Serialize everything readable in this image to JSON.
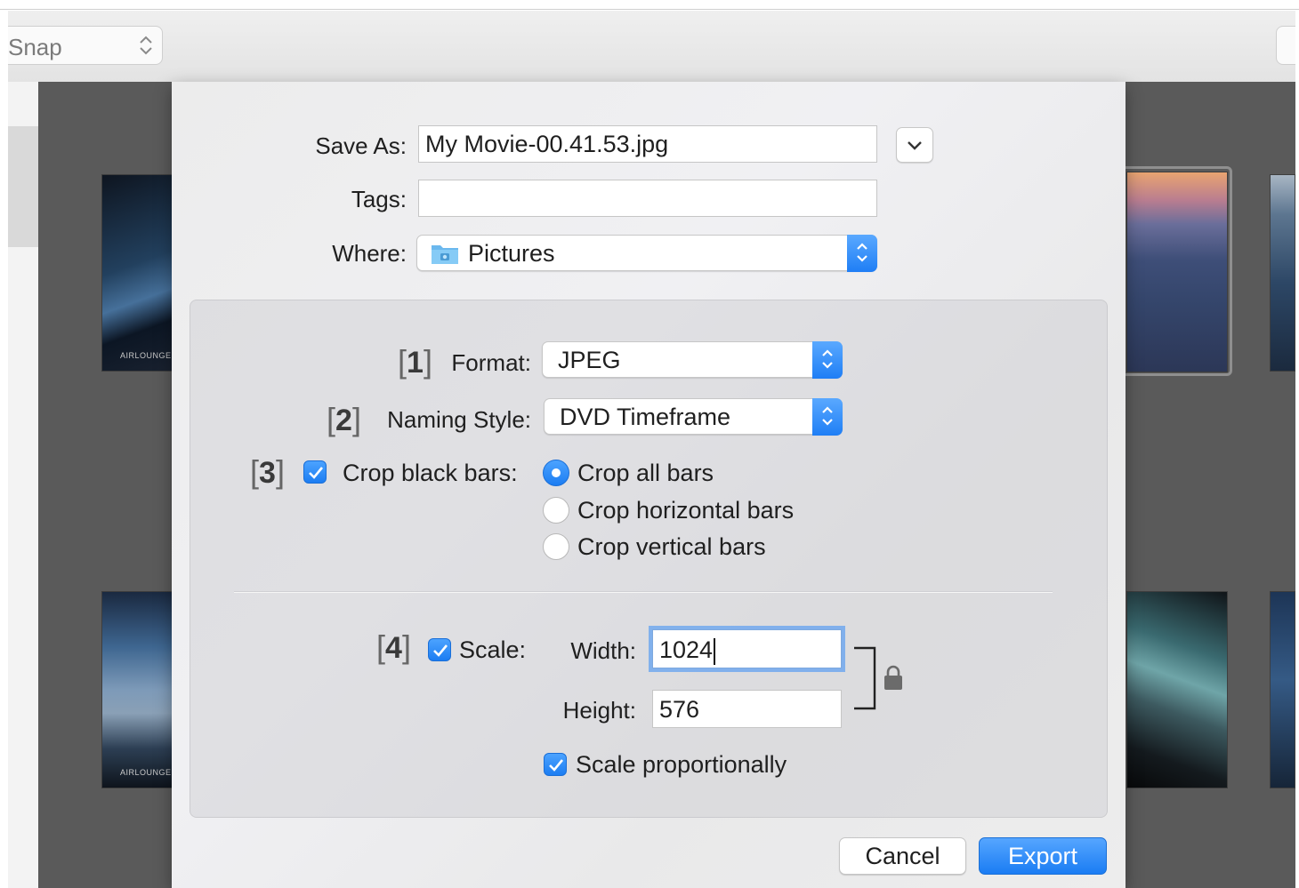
{
  "toolbar": {
    "snap_label": "Snap"
  },
  "thumbnails": {
    "caption": "AIRLOUNGE"
  },
  "dialog": {
    "save_as_label": "Save As:",
    "save_as_value": "My Movie-00.41.53.jpg",
    "tags_label": "Tags:",
    "tags_value": "",
    "where_label": "Where:",
    "where_value": "Pictures",
    "options": {
      "format": {
        "number": "1",
        "label": "Format:",
        "value": "JPEG"
      },
      "naming_style": {
        "number": "2",
        "label": "Naming Style:",
        "value": "DVD Timeframe"
      },
      "crop": {
        "number": "3",
        "label": "Crop black bars:",
        "checked": true,
        "choices": [
          {
            "label": "Crop all bars",
            "selected": true
          },
          {
            "label": "Crop horizontal bars",
            "selected": false
          },
          {
            "label": "Crop vertical bars",
            "selected": false
          }
        ]
      },
      "scale": {
        "number": "4",
        "label": "Scale:",
        "checked": true,
        "width_label": "Width:",
        "width_value": "1024",
        "height_label": "Height:",
        "height_value": "576",
        "proportional_label": "Scale proportionally",
        "proportional_checked": true
      }
    },
    "cancel_label": "Cancel",
    "export_label": "Export"
  },
  "colors": {
    "accent": "#1c7df2",
    "background_window": "#5a5a5a"
  },
  "icons": {
    "folder": "pictures-folder-icon",
    "lock": "lock-icon",
    "expand": "chevron-down-icon"
  }
}
